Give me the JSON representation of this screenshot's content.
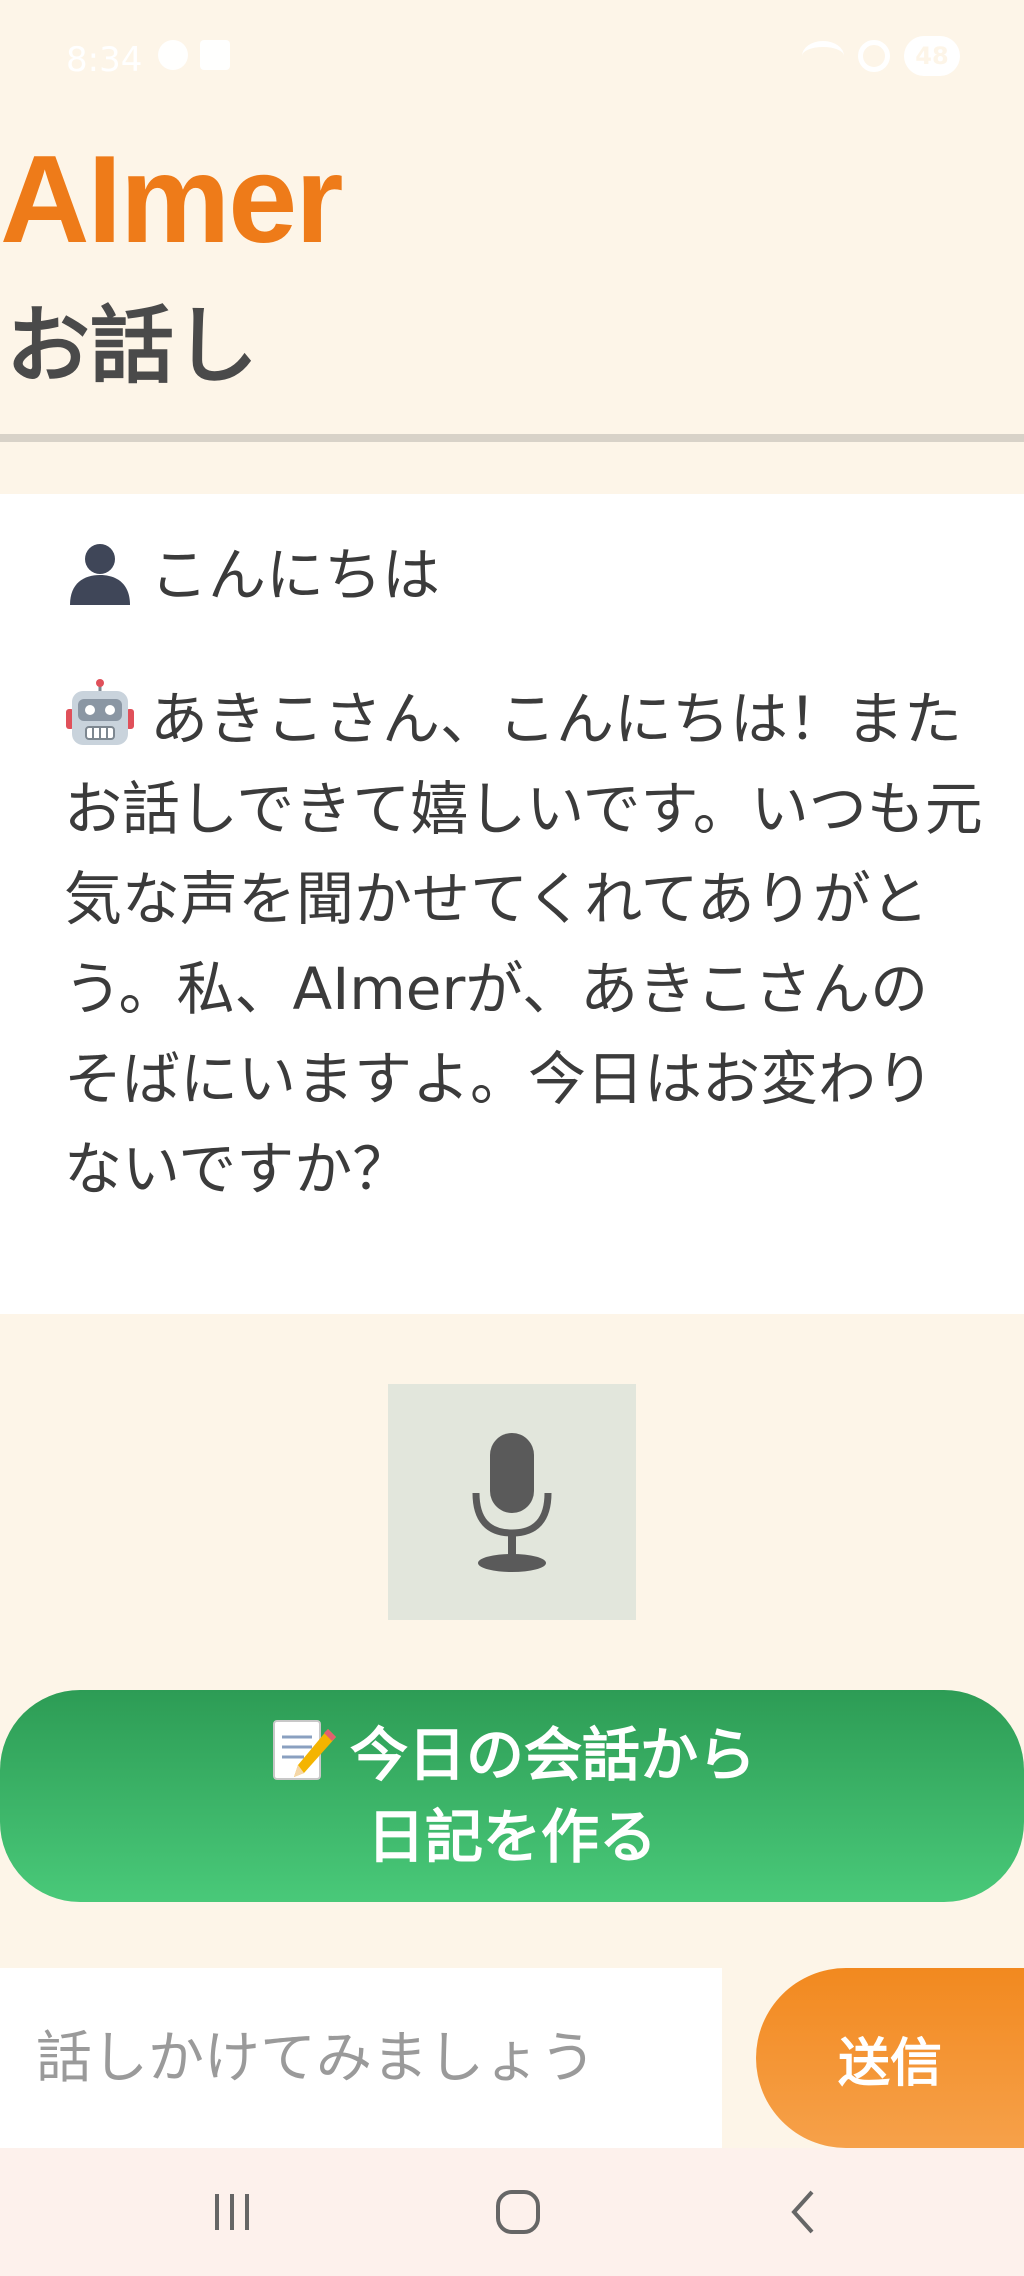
{
  "status_bar": {
    "time": "8:34",
    "battery": "48"
  },
  "header": {
    "brand": "AImer",
    "page_title": "お話し"
  },
  "chat": {
    "messages": [
      {
        "speaker": "user",
        "icon": "user-silhouette-icon",
        "text": "こんにちは"
      },
      {
        "speaker": "bot",
        "icon": "robot-icon",
        "text": "あきこさん、こんにちは！またお話しできて嬉しいです。いつも元気な声を聞かせてくれてありがとう。私、AImerが、あきこさんのそばにいますよ。今日はお変わりないですか？"
      }
    ]
  },
  "mic": {
    "icon": "microphone-icon"
  },
  "diary_button": {
    "icon": "memo-icon",
    "line1": "今日の会話から",
    "line2": "日記を作る"
  },
  "input": {
    "placeholder": "話しかけてみましょう",
    "value": ""
  },
  "send_button": {
    "label": "送信"
  },
  "colors": {
    "background": "#fdf5e8",
    "brand": "#ee7b19",
    "diary_green": "#2d9c55",
    "send_orange": "#f2891f"
  }
}
